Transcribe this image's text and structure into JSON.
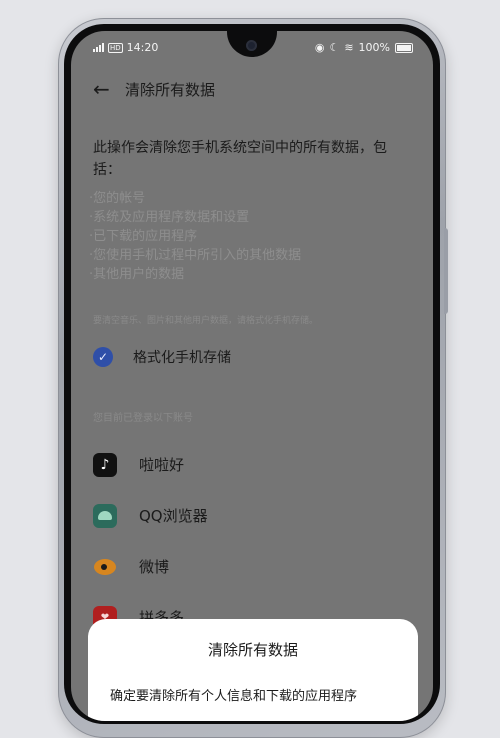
{
  "status_bar": {
    "time": "14:20",
    "battery": "100%",
    "icons": [
      "signal-icon",
      "volte-icon",
      "eye-comfort-icon",
      "moon-icon",
      "wifi-icon",
      "battery-icon"
    ]
  },
  "header": {
    "back_icon": "arrow-left-icon",
    "title": "清除所有数据"
  },
  "description": "此操作会清除您手机系统空间中的所有数据，包括：",
  "bullets": [
    "·您的帐号",
    "·系统及应用程序数据和设置",
    "·已下载的应用程序",
    "·您使用手机过程中所引入的其他数据",
    "·其他用户的数据"
  ],
  "note": "要清空音乐、图片和其他用户数据，请格式化手机存储。",
  "format_option": {
    "label": "格式化手机存储",
    "checked": true
  },
  "accounts_header": "您目前已登录以下账号",
  "accounts": [
    {
      "name": "啦啦好",
      "icon": "tiktok-icon"
    },
    {
      "name": "QQ浏览器",
      "icon": "android-app-icon"
    },
    {
      "name": "微博",
      "icon": "weibo-icon"
    },
    {
      "name": "拼多多",
      "icon": "pinduoduo-icon"
    }
  ],
  "dialog": {
    "title": "清除所有数据",
    "message": "确定要清除所有个人信息和下载的应用程序"
  },
  "colors": {
    "screen_overlay": "#757575",
    "checkbox_accent": "#2f4fa8",
    "dialog_bg": "#ffffff"
  }
}
